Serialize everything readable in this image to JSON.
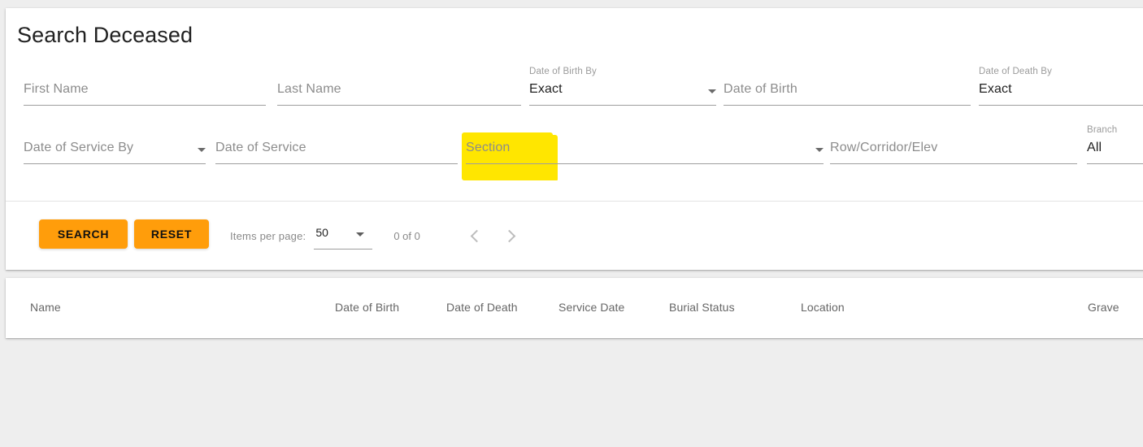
{
  "page": {
    "title": "Search Deceased",
    "background_color": "#eeeeee",
    "accent_color": "#ff9d0b",
    "highlight_color": "#ffe600"
  },
  "form": {
    "fields": [
      {
        "name": "first-name",
        "label": "",
        "value": "First Name",
        "placeholder": true,
        "type": "text"
      },
      {
        "name": "last-name",
        "label": "",
        "value": "Last Name",
        "placeholder": true,
        "type": "text"
      },
      {
        "name": "date-of-birth-by",
        "label": "Date of Birth By",
        "value": "Exact",
        "placeholder": false,
        "type": "select"
      },
      {
        "name": "date-of-birth",
        "label": "",
        "value": "Date of Birth",
        "placeholder": true,
        "type": "text"
      },
      {
        "name": "date-of-death-by",
        "label": "Date of Death By",
        "value": "Exact",
        "placeholder": false,
        "type": "select"
      },
      {
        "name": "date-of-service-by",
        "label": "",
        "value": "Date of Service By",
        "placeholder": true,
        "type": "select"
      },
      {
        "name": "date-of-service",
        "label": "",
        "value": "Date of Service",
        "placeholder": true,
        "type": "text"
      },
      {
        "name": "section",
        "label": "",
        "value": "Section",
        "placeholder": true,
        "type": "select"
      },
      {
        "name": "row-corridor-elev",
        "label": "",
        "value": "Row/Corridor/Elev",
        "placeholder": true,
        "type": "text"
      },
      {
        "name": "branch",
        "label": "Branch",
        "value": "All",
        "placeholder": false,
        "type": "select"
      }
    ]
  },
  "actions": {
    "search_label": "SEARCH",
    "reset_label": "RESET"
  },
  "paginator": {
    "items_per_page_label": "Items per page:",
    "items_per_page_value": "50",
    "range_label": "0 of 0",
    "previous_icon": "chevron-left-icon",
    "next_icon": "chevron-right-icon"
  },
  "table": {
    "columns": [
      {
        "key": "name",
        "label": "Name"
      },
      {
        "key": "date_of_birth",
        "label": "Date of Birth"
      },
      {
        "key": "date_of_death",
        "label": "Date of Death"
      },
      {
        "key": "service_date",
        "label": "Service Date"
      },
      {
        "key": "burial_status",
        "label": "Burial Status"
      },
      {
        "key": "location",
        "label": "Location"
      },
      {
        "key": "grave",
        "label": "Grave"
      }
    ],
    "rows": []
  }
}
